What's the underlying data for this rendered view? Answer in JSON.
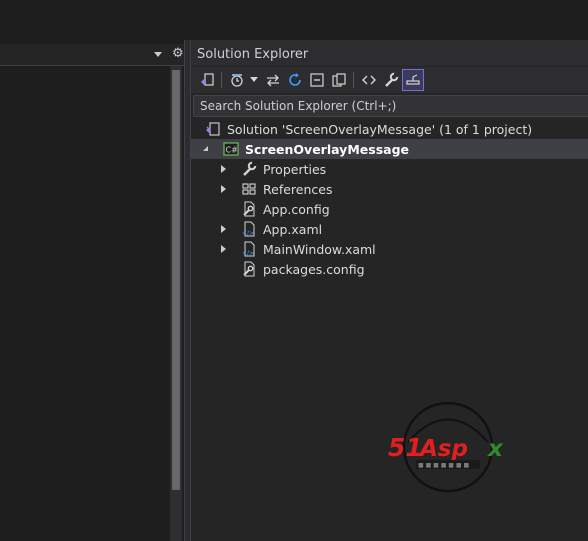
{
  "editor": {
    "gear_icon": "gear-icon",
    "dropdown_icon": "chevron-down-icon"
  },
  "solution_explorer": {
    "title": "Solution Explorer",
    "search": {
      "placeholder": "Search Solution Explorer (Ctrl+;)",
      "value": ""
    },
    "toolbar": [
      {
        "name": "switch-views-icon"
      },
      {
        "name": "pending-changes-filter-icon"
      },
      {
        "name": "sync-with-active-document-icon"
      },
      {
        "name": "refresh-icon"
      },
      {
        "name": "collapse-all-icon"
      },
      {
        "name": "show-all-files-icon"
      },
      {
        "name": "view-code-icon"
      },
      {
        "name": "properties-icon"
      },
      {
        "name": "preview-selected-items-icon"
      }
    ],
    "tree": {
      "solution": "Solution 'ScreenOverlayMessage' (1 of 1 project)",
      "project": "ScreenOverlayMessage",
      "items": [
        {
          "label": "Properties",
          "icon": "wrench-icon",
          "expandable": true
        },
        {
          "label": "References",
          "icon": "references-icon",
          "expandable": true
        },
        {
          "label": "App.config",
          "icon": "config-file-icon",
          "expandable": false
        },
        {
          "label": "App.xaml",
          "icon": "xaml-file-icon",
          "expandable": true
        },
        {
          "label": "MainWindow.xaml",
          "icon": "xaml-file-icon",
          "expandable": true
        },
        {
          "label": "packages.config",
          "icon": "config-file-icon",
          "expandable": false
        }
      ]
    }
  },
  "watermark": {
    "brand": "51Aspx",
    "colors": {
      "red": "#e02020",
      "green": "#2e8b2e"
    }
  },
  "colors": {
    "background": "#1e1e1e",
    "panel": "#252526",
    "selection": "#3f3f46",
    "accent": "#7b6bd8",
    "csharp_green": "#6fbf5a"
  }
}
